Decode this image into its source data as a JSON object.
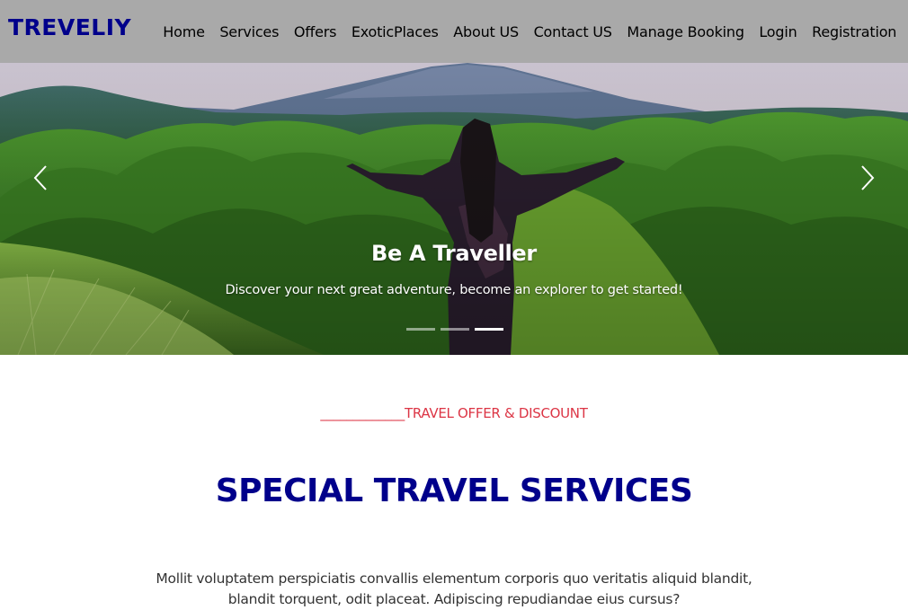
{
  "navbar": {
    "brand": "TREVELIY",
    "links": [
      "Home",
      "Services",
      "Offers",
      "ExoticPlaces",
      "About US",
      "Contact US",
      "Manage Booking",
      "Login",
      "Registration"
    ],
    "background": "#a9a9a9",
    "brand_color": "#00008b"
  },
  "hero": {
    "title": "Be A Traveller",
    "subtitle": "Discover your next great adventure, become an explorer to get started!",
    "prev_icon": "chevron-left-icon",
    "next_icon": "chevron-right-icon",
    "indicator_count": 3,
    "active_indicator": 3
  },
  "section": {
    "eyebrow": "_____________TRAVEL OFFER & DISCOUNT",
    "eyebrow_color": "#dc3545",
    "title": "SPECIAL TRAVEL SERVICES",
    "title_color": "#00008b",
    "paragraph": "Mollit voluptatem perspiciatis convallis elementum corporis quo veritatis aliquid blandit, blandit torquent, odit placeat. Adipiscing repudiandae eius cursus?"
  }
}
